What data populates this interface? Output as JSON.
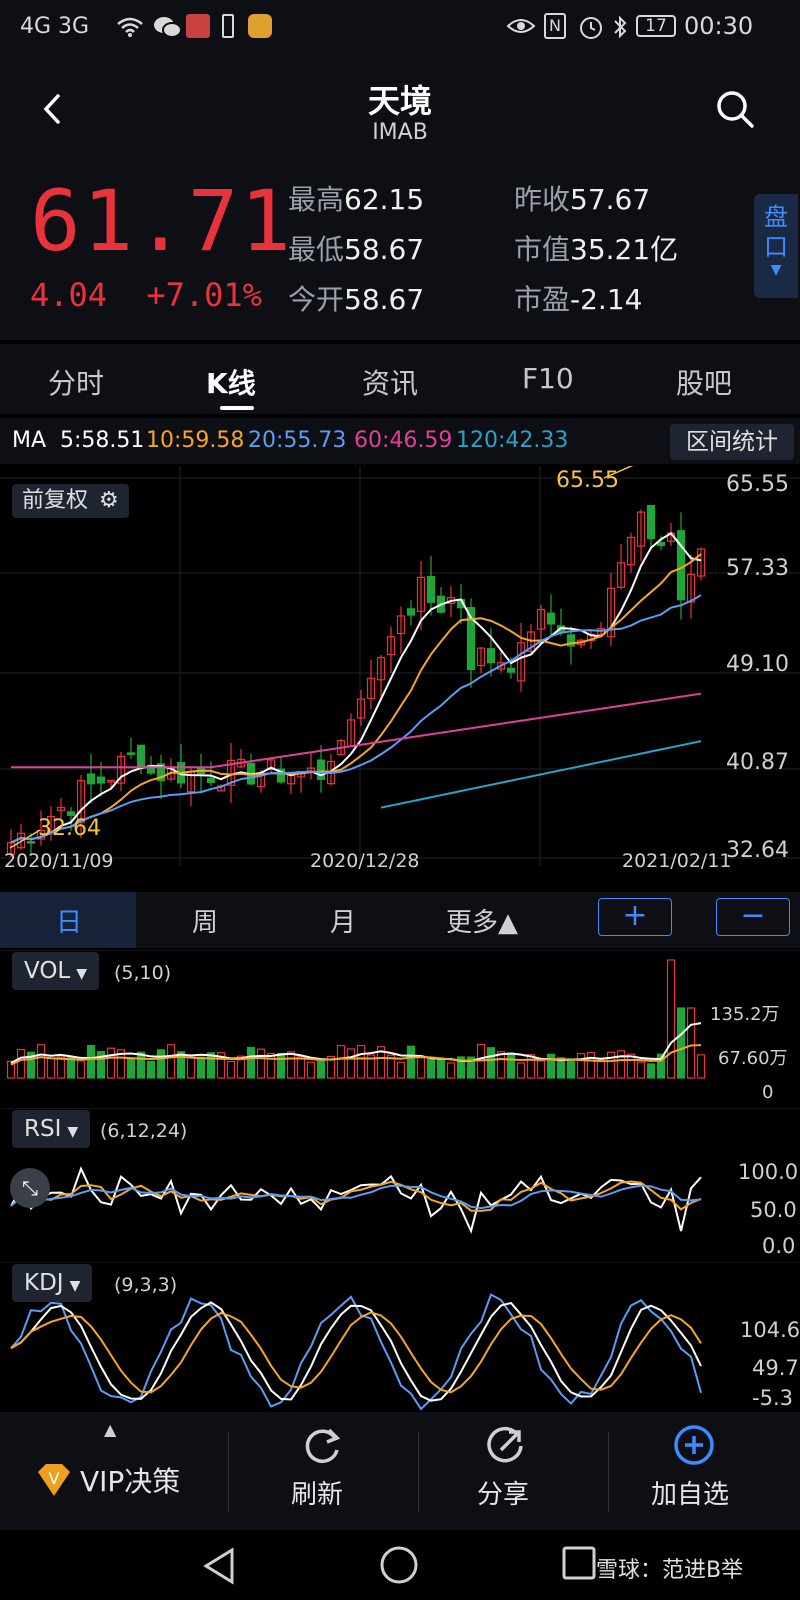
{
  "status_bar": {
    "left": "4G 3G",
    "battery": "17",
    "time": "00:30"
  },
  "header": {
    "title": "天境",
    "ticker": "IMAB",
    "price": "61.71",
    "change": "4.04",
    "change_pct": "+7.01%",
    "stats": [
      {
        "label": "最高",
        "value": "62.15"
      },
      {
        "label": "最低",
        "value": "58.67"
      },
      {
        "label": "今开",
        "value": "58.67"
      },
      {
        "label": "昨收",
        "value": "57.67"
      },
      {
        "label": "市值",
        "value": "35.21亿"
      },
      {
        "label": "市盈",
        "value": "-2.14"
      }
    ],
    "pankou": "盘口"
  },
  "tabs": [
    "分时",
    "K线",
    "资讯",
    "F10",
    "股吧"
  ],
  "active_tab": "K线",
  "ma": {
    "prefix": "MA",
    "items": [
      {
        "text": "5:58.51",
        "color": "#ffffff"
      },
      {
        "text": "10:59.58",
        "color": "#f5a623"
      },
      {
        "text": "20:55.73",
        "color": "#5b9cf5"
      },
      {
        "text": "60:46.59",
        "color": "#e0409a"
      },
      {
        "text": "120:42.33",
        "color": "#29a3c8"
      }
    ],
    "interval_button": "区间统计"
  },
  "chart_controls": {
    "adjust_button": "前复权"
  },
  "chart_data": {
    "type": "candlestick",
    "y_ticks": [
      "65.55",
      "57.33",
      "49.10",
      "40.87",
      "32.64"
    ],
    "ylim": [
      32.64,
      65.55
    ],
    "x_ticks": [
      "2020/11/09",
      "2020/12/28",
      "2021/02/11"
    ],
    "high_label": "65.55",
    "low_label": "32.64"
  },
  "period": {
    "items": [
      "日",
      "周",
      "月",
      "更多▲"
    ],
    "active": "日",
    "plus": "+",
    "minus": "−"
  },
  "vol": {
    "label": "VOL",
    "params": "(5,10)",
    "ticks": [
      "135.2万",
      "67.60万",
      "0"
    ]
  },
  "rsi": {
    "label": "RSI",
    "params": "(6,12,24)",
    "ticks": [
      "100.0",
      "50.0",
      "0.0"
    ]
  },
  "kdj": {
    "label": "KDJ",
    "params": "(9,3,3)",
    "ticks": [
      "104.6",
      "49.7",
      "-5.3"
    ]
  },
  "toolbar": [
    {
      "label": "VIP决策",
      "icon": "vip-diamond-icon"
    },
    {
      "label": "刷新",
      "icon": "refresh-icon"
    },
    {
      "label": "分享",
      "icon": "share-icon"
    },
    {
      "label": "加自选",
      "icon": "add-icon"
    }
  ],
  "watermark": "雪球：范进B举",
  "colors": {
    "up": "#e8323c",
    "down": "#1fa53a",
    "accent": "#3d8cff"
  }
}
